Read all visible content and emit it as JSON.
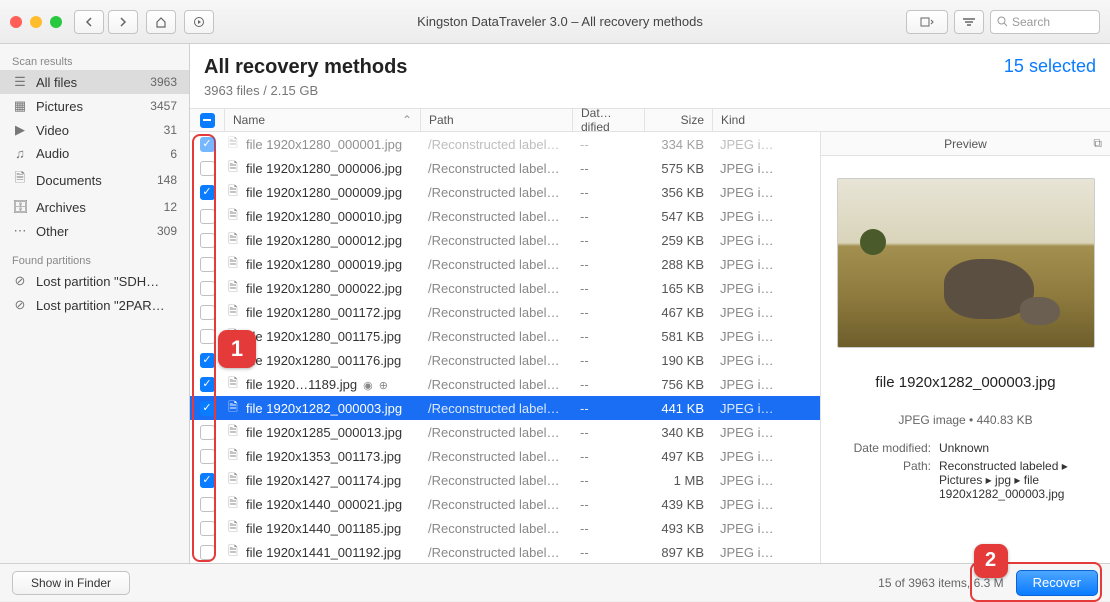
{
  "window": {
    "title": "Kingston DataTraveler 3.0 – All recovery methods",
    "search_placeholder": "Search"
  },
  "sidebar": {
    "scan_header": "Scan results",
    "items": [
      {
        "icon": "☰",
        "label": "All files",
        "count": "3963",
        "selected": true
      },
      {
        "icon": "▦",
        "label": "Pictures",
        "count": "3457"
      },
      {
        "icon": "▶",
        "label": "Video",
        "count": "31"
      },
      {
        "icon": "♫",
        "label": "Audio",
        "count": "6"
      },
      {
        "icon": "🗎",
        "label": "Documents",
        "count": "148"
      },
      {
        "icon": "🗄",
        "label": "Archives",
        "count": "12"
      },
      {
        "icon": "⋯",
        "label": "Other",
        "count": "309"
      }
    ],
    "partitions_header": "Found partitions",
    "partitions": [
      {
        "label": "Lost partition \"SDH…"
      },
      {
        "label": "Lost partition \"2PAR…"
      }
    ]
  },
  "header": {
    "title": "All recovery methods",
    "subtitle": "3963 files / 2.15 GB",
    "selected": "15 selected"
  },
  "columns": {
    "name": "Name",
    "path": "Path",
    "date": "Dat…dified",
    "size": "Size",
    "kind": "Kind"
  },
  "files": [
    {
      "checked": true,
      "name": "file 1920x1280_000001.jpg",
      "path": "/Reconstructed labele…",
      "date": "--",
      "size": "334 KB",
      "kind": "JPEG im…",
      "faded": true
    },
    {
      "checked": false,
      "name": "file 1920x1280_000006.jpg",
      "path": "/Reconstructed labele…",
      "date": "--",
      "size": "575 KB",
      "kind": "JPEG im…"
    },
    {
      "checked": true,
      "name": "file 1920x1280_000009.jpg",
      "path": "/Reconstructed labele…",
      "date": "--",
      "size": "356 KB",
      "kind": "JPEG im…"
    },
    {
      "checked": false,
      "name": "file 1920x1280_000010.jpg",
      "path": "/Reconstructed labele…",
      "date": "--",
      "size": "547 KB",
      "kind": "JPEG im…"
    },
    {
      "checked": false,
      "name": "file 1920x1280_000012.jpg",
      "path": "/Reconstructed labele…",
      "date": "--",
      "size": "259 KB",
      "kind": "JPEG im…"
    },
    {
      "checked": false,
      "name": "file 1920x1280_000019.jpg",
      "path": "/Reconstructed labele…",
      "date": "--",
      "size": "288 KB",
      "kind": "JPEG im…"
    },
    {
      "checked": false,
      "name": "file 1920x1280_000022.jpg",
      "path": "/Reconstructed labele…",
      "date": "--",
      "size": "165 KB",
      "kind": "JPEG im…"
    },
    {
      "checked": false,
      "name": "file 1920x1280_001172.jpg",
      "path": "/Reconstructed labele…",
      "date": "--",
      "size": "467 KB",
      "kind": "JPEG im…"
    },
    {
      "checked": false,
      "name": "file 1920x1280_001175.jpg",
      "path": "/Reconstructed labele…",
      "date": "--",
      "size": "581 KB",
      "kind": "JPEG im…"
    },
    {
      "checked": true,
      "name": "file 1920x1280_001176.jpg",
      "path": "/Reconstructed labele…",
      "date": "--",
      "size": "190 KB",
      "kind": "JPEG im…"
    },
    {
      "checked": true,
      "name": "file 1920…1189.jpg",
      "path": "/Reconstructed labele…",
      "date": "--",
      "size": "756 KB",
      "kind": "JPEG im…",
      "badges": true
    },
    {
      "checked": true,
      "name": "file 1920x1282_000003.jpg",
      "path": "/Reconstructed labele…",
      "date": "--",
      "size": "441 KB",
      "kind": "JPEG im…",
      "selected": true
    },
    {
      "checked": false,
      "name": "file 1920x1285_000013.jpg",
      "path": "/Reconstructed labele…",
      "date": "--",
      "size": "340 KB",
      "kind": "JPEG im…"
    },
    {
      "checked": false,
      "name": "file 1920x1353_001173.jpg",
      "path": "/Reconstructed labele…",
      "date": "--",
      "size": "497 KB",
      "kind": "JPEG im…"
    },
    {
      "checked": true,
      "name": "file 1920x1427_001174.jpg",
      "path": "/Reconstructed labele…",
      "date": "--",
      "size": "1 MB",
      "kind": "JPEG im…"
    },
    {
      "checked": false,
      "name": "file 1920x1440_000021.jpg",
      "path": "/Reconstructed labele…",
      "date": "--",
      "size": "439 KB",
      "kind": "JPEG im…"
    },
    {
      "checked": false,
      "name": "file 1920x1440_001185.jpg",
      "path": "/Reconstructed labele…",
      "date": "--",
      "size": "493 KB",
      "kind": "JPEG im…"
    },
    {
      "checked": false,
      "name": "file 1920x1441_001192.jpg",
      "path": "/Reconstructed labele…",
      "date": "--",
      "size": "897 KB",
      "kind": "JPEG im…"
    }
  ],
  "preview": {
    "label": "Preview",
    "filename": "file 1920x1282_000003.jpg",
    "meta": "JPEG image • 440.83 KB",
    "date_k": "Date modified:",
    "date_v": "Unknown",
    "path_k": "Path:",
    "path_v": "Reconstructed labeled ▸ Pictures ▸ jpg ▸ file 1920x1282_000003.jpg"
  },
  "footer": {
    "finder": "Show in Finder",
    "status": "15 of 3963 items, 6.3 M",
    "recover": "Recover"
  },
  "annotations": {
    "one": "1",
    "two": "2"
  }
}
